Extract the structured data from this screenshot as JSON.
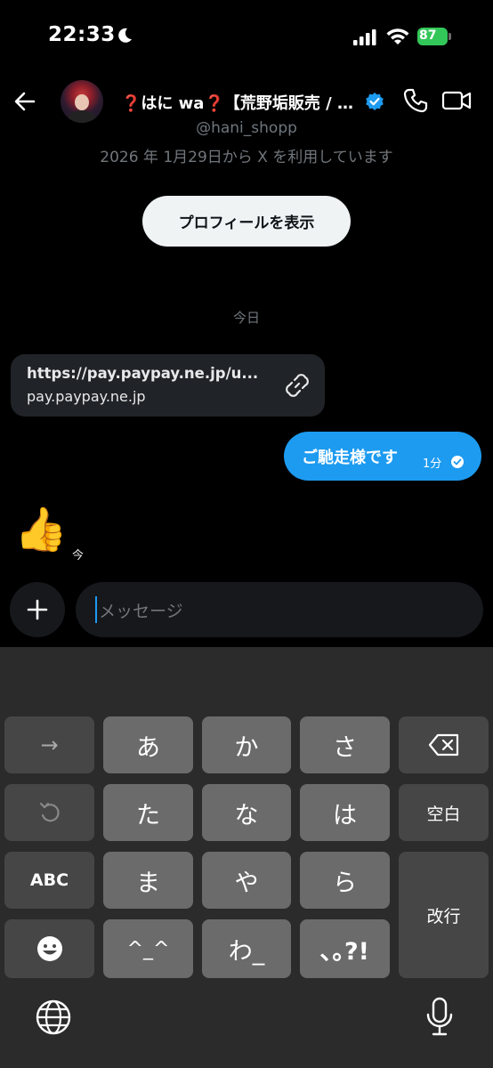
{
  "status_bar": {
    "time": "22:33",
    "battery": "87",
    "moon_icon": "moon-icon",
    "signal_icon": "cellular-signal-icon",
    "wifi_icon": "wifi-icon"
  },
  "header": {
    "back_icon": "back-arrow-icon",
    "title": "❓はに wa❓【荒野垢販売 / …",
    "verified_icon": "verified-badge-icon",
    "phone_icon": "phone-icon",
    "video_icon": "video-icon"
  },
  "conversation": {
    "handle": "@hani_shopp",
    "joined_text": "2026 年 1月29日から X を利用しています",
    "profile_button": "プロフィールを表示",
    "date_separator": "今日",
    "messages": [
      {
        "type": "link",
        "direction": "received",
        "url": "https://pay.paypay.ne.jp/u...",
        "domain": "pay.paypay.ne.jp"
      },
      {
        "type": "text",
        "direction": "sent",
        "text": "ご馳走様です",
        "time": "1分",
        "status_icon": "read-check-icon"
      },
      {
        "type": "emoji",
        "direction": "received",
        "emoji": "👍",
        "time": "今"
      }
    ]
  },
  "composer": {
    "add_icon": "plus-icon",
    "placeholder": "メッセージ"
  },
  "keyboard": {
    "rows": [
      [
        "→",
        "あ",
        "か",
        "さ",
        "⌫"
      ],
      [
        "↺",
        "た",
        "な",
        "は",
        "空白"
      ],
      [
        "ABC",
        "ま",
        "や",
        "ら",
        "改行"
      ],
      [
        "☺",
        "^_^",
        "わ_",
        "､｡?!"
      ]
    ],
    "globe_icon": "globe-icon",
    "mic_icon": "microphone-icon",
    "colors": {
      "key": "#6b6b6b",
      "key_dark": "#464646",
      "background": "#2b2b2b"
    }
  },
  "colors": {
    "accent": "#1d9bf0",
    "background": "#000000",
    "battery": "#33c759"
  }
}
